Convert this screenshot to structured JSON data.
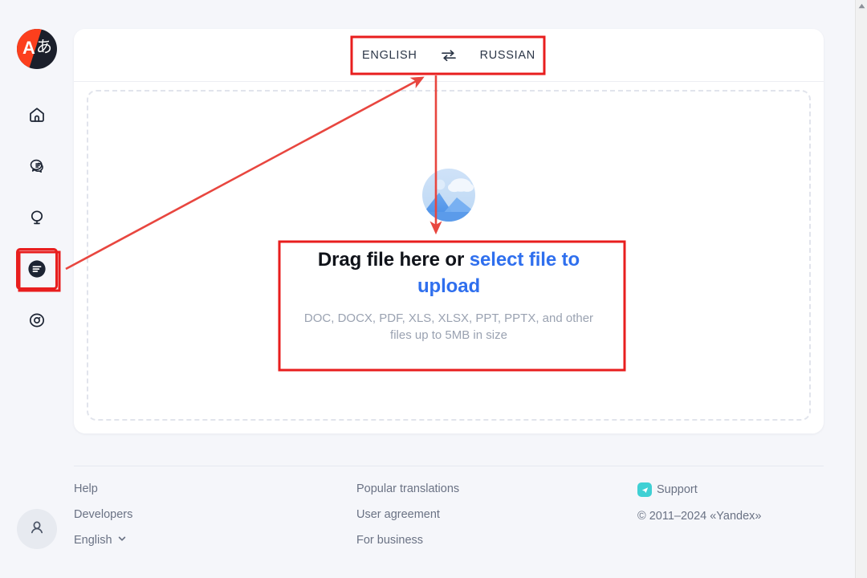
{
  "app": {
    "logo": {
      "name": "yandex-translate-logo",
      "letter_latin": "A",
      "letter_japanese": "あ",
      "color_red": "#fc3f1d",
      "color_dark": "#1b1f2b"
    },
    "accent_link_color": "#2f6fee",
    "annotation_color": "#e81e1e"
  },
  "sidebar": {
    "items": [
      {
        "icon": "home-icon",
        "label": "Home",
        "selected": false
      },
      {
        "icon": "chat-translate-icon",
        "label": "Text translation",
        "selected": false
      },
      {
        "icon": "globe-site-icon",
        "label": "Site translation",
        "selected": false
      },
      {
        "icon": "document-icon",
        "label": "Document translation",
        "selected": true
      },
      {
        "icon": "camera-image-icon",
        "label": "Image translation",
        "selected": false
      }
    ],
    "account": {
      "icon": "user-avatar-icon",
      "label": "Account"
    }
  },
  "language_bar": {
    "source_language": "ENGLISH",
    "target_language": "RUSSIAN",
    "swap_icon": "swap-horizontal-icon"
  },
  "dropzone": {
    "illustration": "image-landscape-icon",
    "title_static": "Drag file here or ",
    "title_link": "select file to upload",
    "subtitle": "DOC, DOCX, PDF, XLS, XLSX, PPT, PPTX, and other files up to 5MB in size"
  },
  "footer": {
    "column1": [
      {
        "label": "Help",
        "type": "link"
      },
      {
        "label": "Developers",
        "type": "link"
      },
      {
        "label": "English",
        "type": "language-select",
        "icon": "chevron-down-icon"
      }
    ],
    "column2": [
      {
        "label": "Popular translations",
        "type": "link"
      },
      {
        "label": "User agreement",
        "type": "link"
      },
      {
        "label": "For business",
        "type": "link"
      }
    ],
    "column3": [
      {
        "label": "Support",
        "type": "link",
        "icon": "support-telegram-icon",
        "icon_color": "#3fd0d4"
      },
      {
        "label": "© 2011–2024 «Yandex»",
        "type": "static"
      }
    ]
  },
  "scrollbar": {
    "up_arrow_icon": "scroll-up-arrow-icon"
  },
  "annotations": {
    "highlight_boxes": [
      {
        "name": "document-nav-highlight",
        "target": "sidebar document icon"
      },
      {
        "name": "language-bar-highlight",
        "target": "ENGLISH / RUSSIAN switcher"
      },
      {
        "name": "dropzone-highlight",
        "target": "Drag file here area"
      }
    ],
    "arrows": [
      {
        "name": "arrow-nav-to-language-bar",
        "from": "document nav icon",
        "to": "language bar"
      },
      {
        "name": "arrow-language-bar-to-dropzone",
        "from": "language bar",
        "to": "dropzone"
      }
    ]
  }
}
